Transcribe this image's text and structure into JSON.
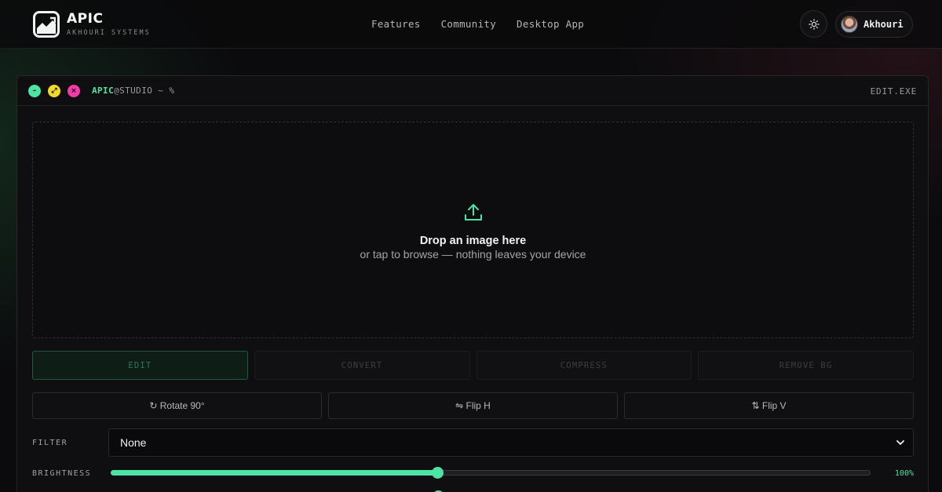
{
  "header": {
    "brand_name": "APIC",
    "brand_sub": "AKHOURI SYSTEMS",
    "nav": [
      "Features",
      "Community",
      "Desktop App"
    ],
    "theme_icon": "sun-icon",
    "user_name": "Akhouri"
  },
  "window": {
    "prompt_app": "APIC",
    "prompt_rest": "@STUDIO ~ %",
    "exe_label": "EDIT.EXE"
  },
  "dropzone": {
    "icon": "upload-icon",
    "title": "Drop an image here",
    "subtitle": "or tap to browse — nothing leaves your device"
  },
  "tabs": [
    {
      "label": "EDIT",
      "active": true
    },
    {
      "label": "CONVERT",
      "active": false
    },
    {
      "label": "COMPRESS",
      "active": false
    },
    {
      "label": "REMOVE BG",
      "active": false
    }
  ],
  "tools": [
    "↻ Rotate 90°",
    "⇋ Flip H",
    "⇅ Flip V"
  ],
  "filter": {
    "label": "FILTER",
    "value": "None"
  },
  "brightness": {
    "label": "BRIGHTNESS",
    "value_text": "100%",
    "fraction": 0.43
  },
  "colors": {
    "accent": "#4ce3a4",
    "background": "#0b0b0d"
  }
}
